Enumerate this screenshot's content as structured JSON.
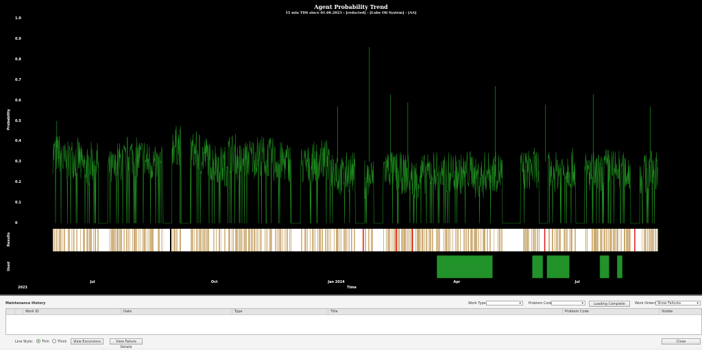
{
  "chart": {
    "title": "Agent Probability Trend",
    "subtitle": "15 min TDS since 01.06.2023 - [redacted] - [Lube Oil System] - [AA]",
    "ylabel": "Probability",
    "xlabel": "Time",
    "results_label": "Results",
    "used_label": "Used",
    "year_label": "2023"
  },
  "chart_data": {
    "type": "line",
    "title": "Agent Probability Trend",
    "ylabel": "Probability",
    "xlabel": "Time",
    "ylim": [
      0,
      1.0
    ],
    "yticks": [
      "0",
      "0.1",
      "0.2",
      "0.3",
      "0.4",
      "0.5",
      "0.6",
      "0.7",
      "0.8",
      "0.9",
      "1.0"
    ],
    "xlim": [
      "2023-06-01",
      "2024-08-31"
    ],
    "xticks": [
      {
        "date": "2023-07-01",
        "label": "Jul"
      },
      {
        "date": "2023-10-01",
        "label": "Oct"
      },
      {
        "date": "2024-01-01",
        "label": "Jan 2024"
      },
      {
        "date": "2024-04-01",
        "label": "Apr"
      },
      {
        "date": "2024-07-01",
        "label": "Jul"
      }
    ],
    "series_color": "#1f8a1f",
    "weekly_mean_probability": [
      0.34,
      0.3,
      0.32,
      0.28,
      0.3,
      0.0,
      0.26,
      0.3,
      0.33,
      0.32,
      0.3,
      0.28,
      0.0,
      0.38,
      0.0,
      0.35,
      0.33,
      0.3,
      0.28,
      0.34,
      0.3,
      0.32,
      0.33,
      0.32,
      0.3,
      0.3,
      0.0,
      0.28,
      0.3,
      0.31,
      0.27,
      0.23,
      0.25,
      0.0,
      0.22,
      0.0,
      0.27,
      0.25,
      0.24,
      0.22,
      0.24,
      0.26,
      0.23,
      0.25,
      0.24,
      0.26,
      0.22,
      0.25,
      0.25,
      0.0,
      0.0,
      0.26,
      0.27,
      0.0,
      0.25,
      0.26,
      0.27,
      0.0,
      0.25,
      0.24,
      0.27,
      0.26,
      0.25,
      0.0,
      0.24,
      0.26
    ],
    "peaks": [
      {
        "date": "2023-06-04",
        "value": 0.5
      },
      {
        "date": "2024-01-02",
        "value": 0.57
      },
      {
        "date": "2024-01-26",
        "value": 0.86
      },
      {
        "date": "2024-02-11",
        "value": 0.63
      },
      {
        "date": "2024-02-24",
        "value": 0.59
      },
      {
        "date": "2024-04-30",
        "value": 0.67
      },
      {
        "date": "2024-06-07",
        "value": 0.58
      },
      {
        "date": "2024-07-13",
        "value": 0.63
      },
      {
        "date": "2024-08-25",
        "value": 0.57
      }
    ],
    "results_colors": {
      "normal": "#c8a56a",
      "alarm": "#e01010",
      "none": "#ffffff"
    },
    "results_alarms": [
      "2024-01-21",
      "2024-02-15",
      "2024-02-27",
      "2024-06-06",
      "2024-08-13"
    ],
    "used_periods": [
      [
        "2024-03-17",
        "2024-04-28"
      ],
      [
        "2024-05-28",
        "2024-06-05"
      ],
      [
        "2024-06-08",
        "2024-06-25"
      ],
      [
        "2024-07-18",
        "2024-07-25"
      ],
      [
        "2024-07-31",
        "2024-08-04"
      ]
    ],
    "used_color": "#22922a"
  },
  "maintenance": {
    "title": "Maintenance History",
    "work_type_label": "Work Type:",
    "work_type_value": "",
    "problem_code_label": "Problem Code:",
    "problem_code_value": "",
    "loading_button": "Loading Complete",
    "work_orders_label": "Work Orders:",
    "work_orders_value": "Show Failures",
    "columns": [
      "Work ID",
      "Date",
      "Type",
      "Title",
      "Problem Code",
      "Visible"
    ],
    "rows": [],
    "line_style_label": "Line Style:",
    "thin_label": "Thin",
    "thick_label": "Thick",
    "line_style_selected": "Thin",
    "view_excursions": "View Excursions",
    "view_failure_details": "View Failure Details",
    "close": "Close"
  }
}
